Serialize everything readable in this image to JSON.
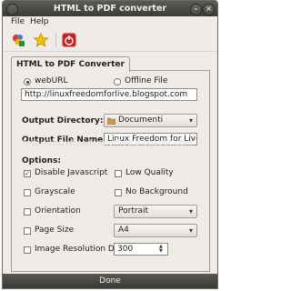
{
  "window": {
    "title": "HTML to PDF converter",
    "close_glyph": "×",
    "minimize_glyph": "–"
  },
  "menu": {
    "file": "File",
    "help": "Help"
  },
  "toolbar": {
    "icons": [
      "convert-icon",
      "star-icon",
      "quit-icon"
    ]
  },
  "tab": {
    "label": "HTML to PDF Converter"
  },
  "source": {
    "web_url_label": "webURL",
    "offline_label": "Offline File",
    "selected": "webURL",
    "url_value": "http://linuxfreedomforlive.blogspot.com"
  },
  "output": {
    "directory_label": "Output Directory:",
    "directory_value": "Documenti",
    "file_name_label": "Output File Name:",
    "file_name_value": "Linux Freedom for Live"
  },
  "options": {
    "heading": "Options:",
    "disable_js": {
      "label": "Disable Javascript",
      "checked": true
    },
    "low_quality": {
      "label": "Low Quality",
      "checked": false
    },
    "grayscale": {
      "label": "Grayscale",
      "checked": false
    },
    "no_background": {
      "label": "No Background",
      "checked": false
    },
    "orientation": {
      "label": "Orientation",
      "checked": false,
      "value": "Portrait"
    },
    "page_size": {
      "label": "Page Size",
      "checked": false,
      "value": "A4"
    },
    "image_dpi": {
      "label": "Image Resolution DPI",
      "checked": false,
      "value": "300"
    }
  },
  "watermark": "http://linuxfreedomforlive.blogspot.com",
  "footer": {
    "done_label": "Done"
  },
  "colors": {
    "titlebar": "#3e3c38",
    "window_bg": "#efebe7",
    "quit_red": "#cc2222",
    "star_yellow": "#f2c200"
  }
}
